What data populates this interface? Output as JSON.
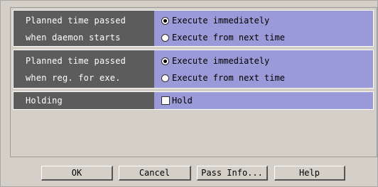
{
  "settings": {
    "daemon_start": {
      "label_line1": "Planned time passed",
      "label_line2": "when daemon starts",
      "options": [
        "Execute immediately",
        "Execute from next time"
      ],
      "selected": 0
    },
    "reg_for_exe": {
      "label_line1": "Planned time passed",
      "label_line2": "when reg. for exe.",
      "options": [
        "Execute immediately",
        "Execute from next time"
      ],
      "selected": 0
    },
    "holding": {
      "label": "Holding",
      "checkbox_label": "Hold",
      "checked": false
    }
  },
  "buttons": {
    "ok": "OK",
    "cancel": "Cancel",
    "pass_info": "Pass Info...",
    "help": "Help"
  },
  "colors": {
    "label_bg": "#5c5c5c",
    "option_bg": "#9a9ad8",
    "dialog_bg": "#d4d0c8"
  }
}
